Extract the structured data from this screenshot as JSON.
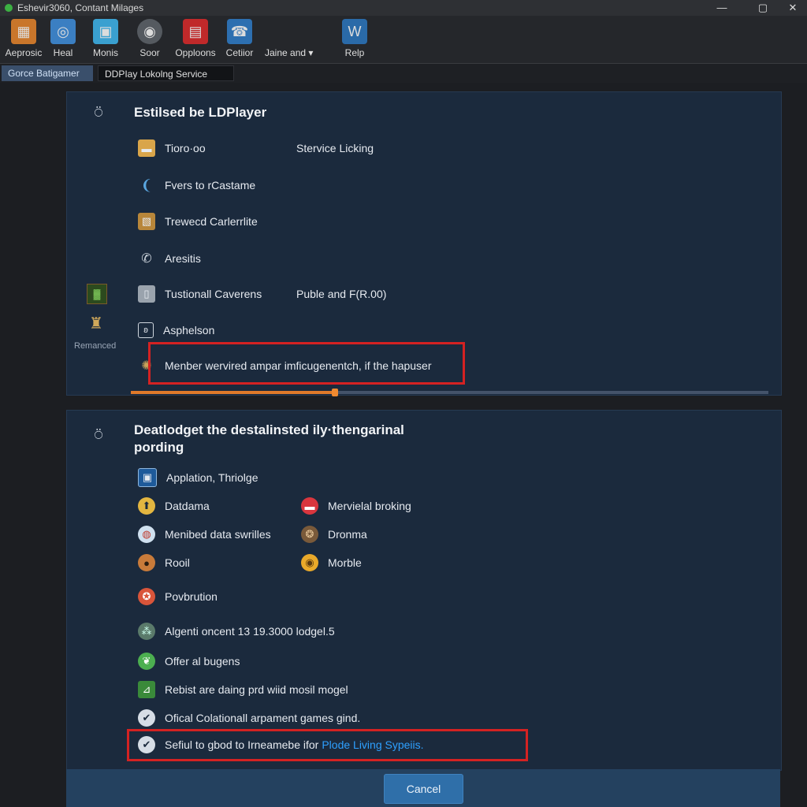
{
  "window": {
    "title": "Eshevir3060, Contant Milages",
    "controls": {
      "minimize": "—",
      "maximize": "▢",
      "close": "✕"
    }
  },
  "toolbar": {
    "items": [
      {
        "label": "Aeprosic",
        "icon": "apps-icon",
        "color": "#c9762b"
      },
      {
        "label": "Heal",
        "icon": "heal-icon",
        "color": "#3b7fc2"
      },
      {
        "label": "Monis",
        "icon": "monitor-icon",
        "color": "#3aa0d0"
      },
      {
        "label": "Soor",
        "icon": "disc-icon",
        "color": "#555a60"
      },
      {
        "label": "Opploons",
        "icon": "options-icon",
        "color": "#c0292a"
      },
      {
        "label": "Cetiior",
        "icon": "phone-icon",
        "color": "#2d6fb0"
      },
      {
        "label": "Relp",
        "icon": "help-icon",
        "color": "#2a6aa8"
      }
    ],
    "select": {
      "value": "Jaine and",
      "caret": "▾"
    }
  },
  "tabs": [
    {
      "label": "Gorce Batigamer",
      "active": true
    },
    {
      "label": "DDPIay  Lokolng Service",
      "active": false
    }
  ],
  "panel1": {
    "title": "Estilsed be LDPlayer",
    "rows": [
      {
        "label": "Tioro·oo",
        "right": "Stervice Licking",
        "icon": "folder-icon"
      },
      {
        "label": "Fvers to rCastame",
        "icon": "swirl-icon"
      },
      {
        "label": "Trewecd Carlerrlite",
        "icon": "gallery-icon"
      },
      {
        "label": "Aresitis",
        "icon": "phone-icon"
      },
      {
        "label": "Tustionall Caverens",
        "right": "Puble and F(R.00)",
        "icon": "clipboard-icon"
      },
      {
        "label": "Asphelson",
        "icon": "info-icon"
      },
      {
        "label": "Menber wervired ampar imficugenentch, if the hapuser",
        "icon": "gear-icon"
      }
    ],
    "side_label": "Remanced",
    "progress": 0.32
  },
  "panel2": {
    "title_line1": "Deatlodget the destalinsted ily·thengarinal",
    "title_line2": "pording",
    "rows_left": [
      {
        "label": "Applation, Thriolge",
        "icon": "app-icon"
      },
      {
        "label": "Datdama",
        "icon": "upload-icon"
      },
      {
        "label": "Menibed data swrilles",
        "icon": "globe-icon"
      },
      {
        "label": "Rooil",
        "icon": "drop-icon"
      },
      {
        "label": "Povbrution",
        "icon": "badge-icon"
      },
      {
        "label": "Algenti oncent 13 19.3000 lodgel.5",
        "icon": "network-icon"
      },
      {
        "label": "Offer al bugens",
        "icon": "leaf-icon"
      },
      {
        "label": "Rebist are daing prd wiid mosil mogel",
        "icon": "chart-icon"
      },
      {
        "label": "Ofical Colationall arpament games gind.",
        "icon": "check-icon"
      }
    ],
    "rows_right": [
      {
        "label": "Mervielal broking",
        "icon": "block-icon"
      },
      {
        "label": "Dronma",
        "icon": "bear-icon"
      },
      {
        "label": "Morble",
        "icon": "coin-icon"
      }
    ],
    "highlight_row": {
      "prefix": "Sefiul to gbod to Irneamebe ifor",
      "link": "Plode Living Sypeiis."
    }
  },
  "footer": {
    "cancel_label": "Cancel"
  },
  "colors": {
    "panel_bg": "#1b2a3d",
    "highlight": "#d42222",
    "progress": "#e07a2a",
    "button": "#2f6fa9"
  }
}
